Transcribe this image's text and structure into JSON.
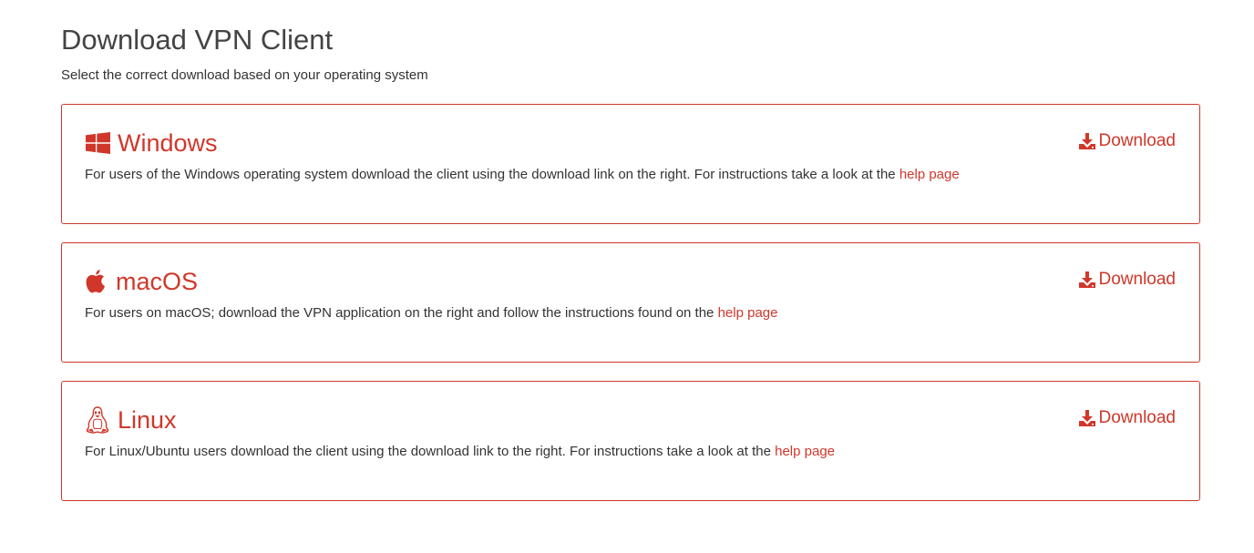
{
  "page": {
    "title": "Download VPN Client",
    "subtitle": "Select the correct download based on your operating system"
  },
  "accent_color": "#d0372a",
  "cards": [
    {
      "icon": "windows-icon",
      "name": "Windows",
      "description": "For users of the Windows operating system download the client using the download link on the right. For instructions take a look at the ",
      "help_label": "help page",
      "download_icon": "download-icon",
      "download_label": "Download"
    },
    {
      "icon": "apple-icon",
      "name": "macOS",
      "description": "For users on macOS; download the VPN application on the right and follow the instructions found on the ",
      "help_label": "help page",
      "download_icon": "download-icon",
      "download_label": "Download"
    },
    {
      "icon": "linux-icon",
      "name": "Linux",
      "description": "For Linux/Ubuntu users download the client using the download link to the right. For instructions take a look at the ",
      "help_label": "help page",
      "download_icon": "download-icon",
      "download_label": "Download"
    }
  ]
}
